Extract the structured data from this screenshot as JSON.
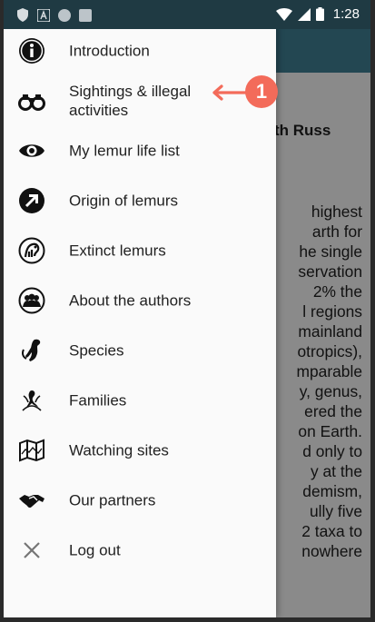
{
  "status_bar": {
    "time": "1:28",
    "icons": [
      "shield-icon",
      "a-icon",
      "circle-icon",
      "square-icon",
      "wifi-icon",
      "signal-icon",
      "battery-icon"
    ]
  },
  "background_content": {
    "title_fragment": "th Russ",
    "paragraph_fragments": [
      "highest",
      "arth for",
      "he single",
      "servation",
      "2% the",
      "l regions",
      "mainland",
      "otropics),",
      "mparable",
      "y, genus,",
      "ered the",
      "on Earth.",
      "d only to",
      "y at the",
      "demism,",
      "ully five",
      "2 taxa to",
      "nowhere"
    ]
  },
  "drawer": {
    "items": [
      {
        "label": "Introduction",
        "icon": "info-icon"
      },
      {
        "label": "Sightings & illegal activities",
        "icon": "binoculars-icon"
      },
      {
        "label": "My lemur life list",
        "icon": "eye-icon"
      },
      {
        "label": "Origin of lemurs",
        "icon": "arrow-icon"
      },
      {
        "label": "Extinct lemurs",
        "icon": "extinct-lemur-icon"
      },
      {
        "label": "About the authors",
        "icon": "authors-icon"
      },
      {
        "label": "Species",
        "icon": "lemur-icon"
      },
      {
        "label": "Families",
        "icon": "family-icon"
      },
      {
        "label": "Watching sites",
        "icon": "map-icon"
      },
      {
        "label": "Our partners",
        "icon": "handshake-icon"
      },
      {
        "label": "Log out",
        "icon": "close-icon"
      }
    ]
  },
  "annotation": {
    "number": "1",
    "color": "#f36b5a"
  }
}
